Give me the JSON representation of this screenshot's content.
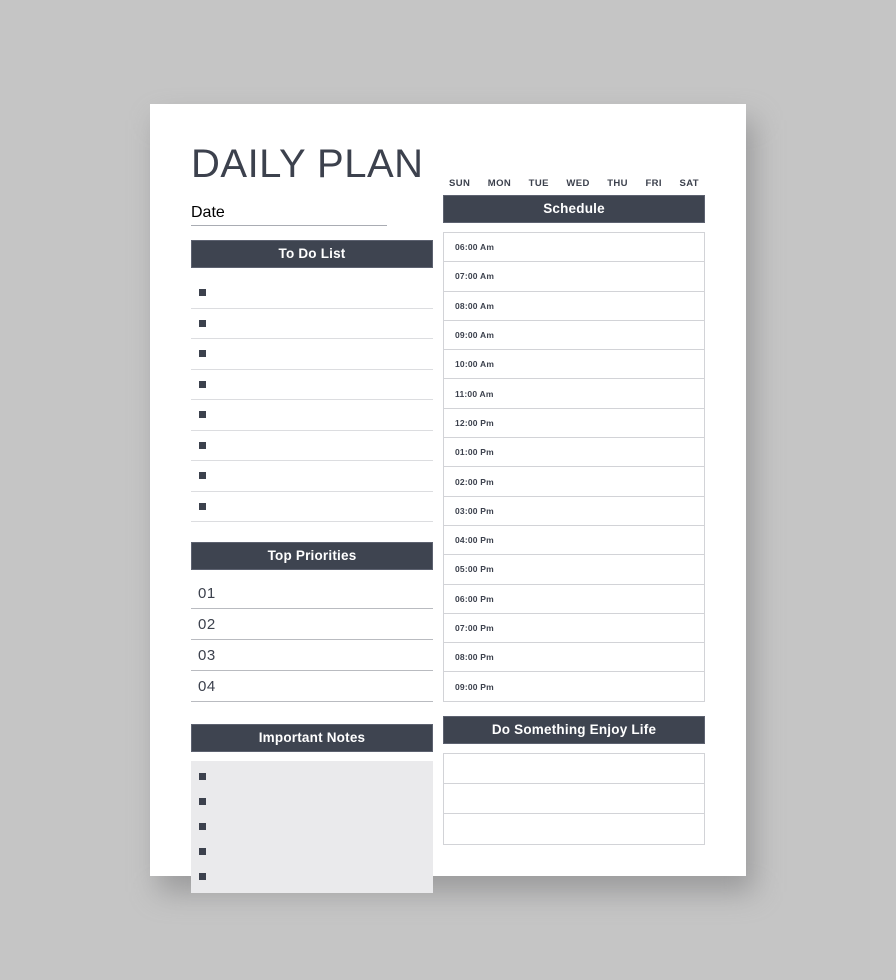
{
  "page": {
    "title": "DAILY PLAN",
    "date_label": "Date",
    "background_color": "#c5c5c5",
    "sheet_color": "#ffffff",
    "accent_color": "#3e4450",
    "notes_bg_color": "#eaeaec",
    "rule_color": "#d2d3d7"
  },
  "todo": {
    "heading": "To Do List",
    "bullet_icon": "filled-square",
    "rows": [
      "",
      "",
      "",
      "",
      "",
      "",
      "",
      ""
    ]
  },
  "priorities": {
    "heading": "Top Priorities",
    "rows": [
      {
        "number": "01",
        "value": ""
      },
      {
        "number": "02",
        "value": ""
      },
      {
        "number": "03",
        "value": ""
      },
      {
        "number": "04",
        "value": ""
      }
    ]
  },
  "notes": {
    "heading": "Important Notes",
    "bullet_icon": "filled-square",
    "rows": [
      "",
      "",
      "",
      "",
      ""
    ]
  },
  "schedule": {
    "heading": "Schedule",
    "days": [
      "SUN",
      "MON",
      "TUE",
      "WED",
      "THU",
      "FRI",
      "SAT"
    ],
    "rows": [
      {
        "time": "06:00 Am",
        "value": ""
      },
      {
        "time": "07:00 Am",
        "value": ""
      },
      {
        "time": "08:00 Am",
        "value": ""
      },
      {
        "time": "09:00 Am",
        "value": ""
      },
      {
        "time": "10:00 Am",
        "value": ""
      },
      {
        "time": "11:00 Am",
        "value": ""
      },
      {
        "time": "12:00 Pm",
        "value": ""
      },
      {
        "time": "01:00 Pm",
        "value": ""
      },
      {
        "time": "02:00 Pm",
        "value": ""
      },
      {
        "time": "03:00 Pm",
        "value": ""
      },
      {
        "time": "04:00 Pm",
        "value": ""
      },
      {
        "time": "05:00 Pm",
        "value": ""
      },
      {
        "time": "06:00 Pm",
        "value": ""
      },
      {
        "time": "07:00 Pm",
        "value": ""
      },
      {
        "time": "08:00 Pm",
        "value": ""
      },
      {
        "time": "09:00 Pm",
        "value": ""
      }
    ]
  },
  "enjoy": {
    "heading": "Do Something Enjoy Life",
    "rows": [
      "",
      "",
      ""
    ]
  }
}
